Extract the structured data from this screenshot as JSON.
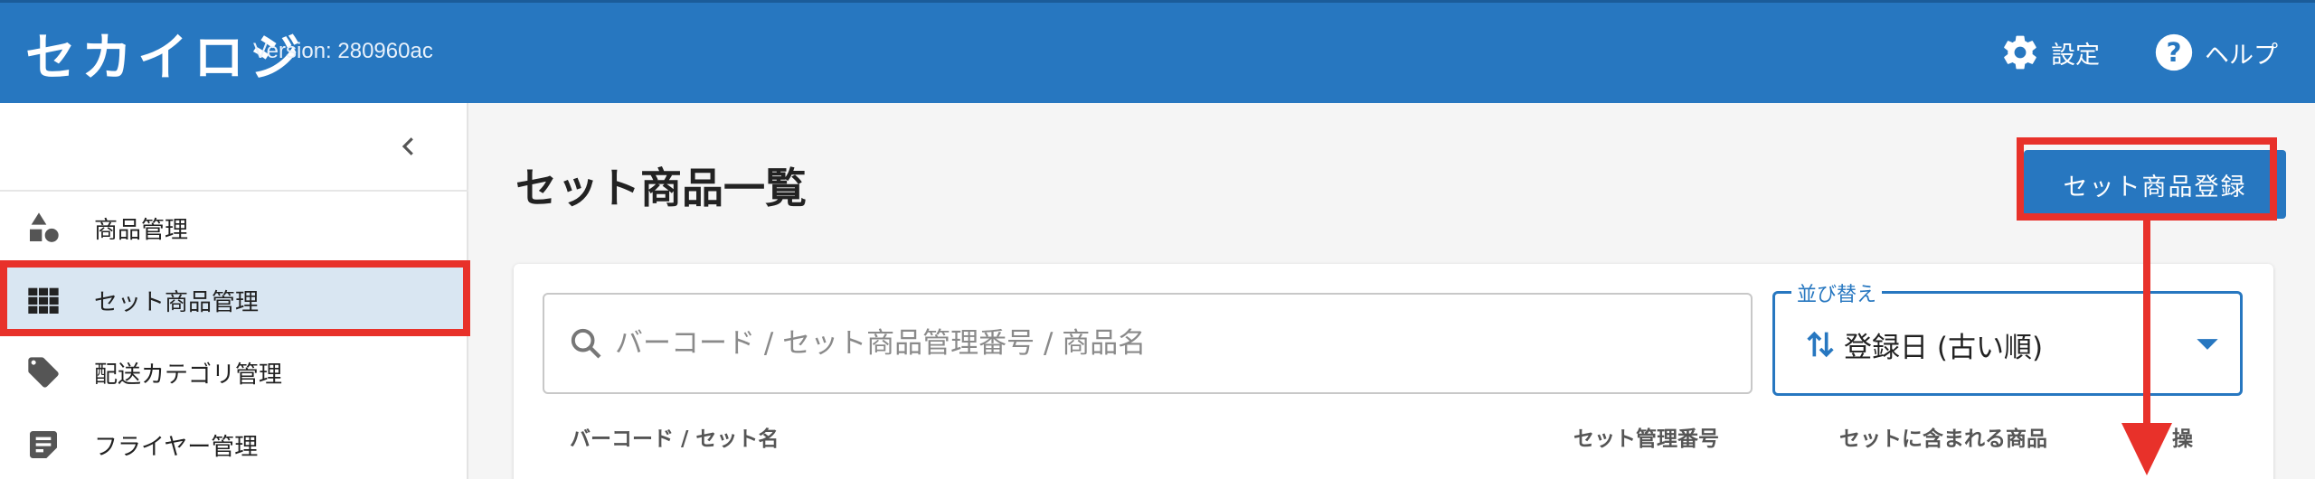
{
  "header": {
    "logo_text": "セカイロジ",
    "version": "Version: 280960ac",
    "settings_label": "設定",
    "help_label": "ヘルプ",
    "bg_color": "#2777c0"
  },
  "sidebar": {
    "collapse_icon": "chevron-left-icon",
    "items": [
      {
        "label": "商品管理",
        "icon": "shapes-icon",
        "active": false
      },
      {
        "label": "セット商品管理",
        "icon": "grid-icon",
        "active": true
      },
      {
        "label": "配送カテゴリ管理",
        "icon": "tag-icon",
        "active": false
      },
      {
        "label": "フライヤー管理",
        "icon": "note-icon",
        "active": false
      }
    ]
  },
  "main": {
    "title": "セット商品一覧",
    "register_button": "セット商品登録",
    "search": {
      "placeholder": "バーコード / セット商品管理番号 / 商品名",
      "value": ""
    },
    "sort": {
      "label": "並び替え",
      "value": "登録日 (古い順)"
    },
    "table_headers": [
      "バーコード / セット名",
      "セット管理番号",
      "セットに含まれる商品",
      "操"
    ]
  },
  "annotation_color": "#e8312a"
}
